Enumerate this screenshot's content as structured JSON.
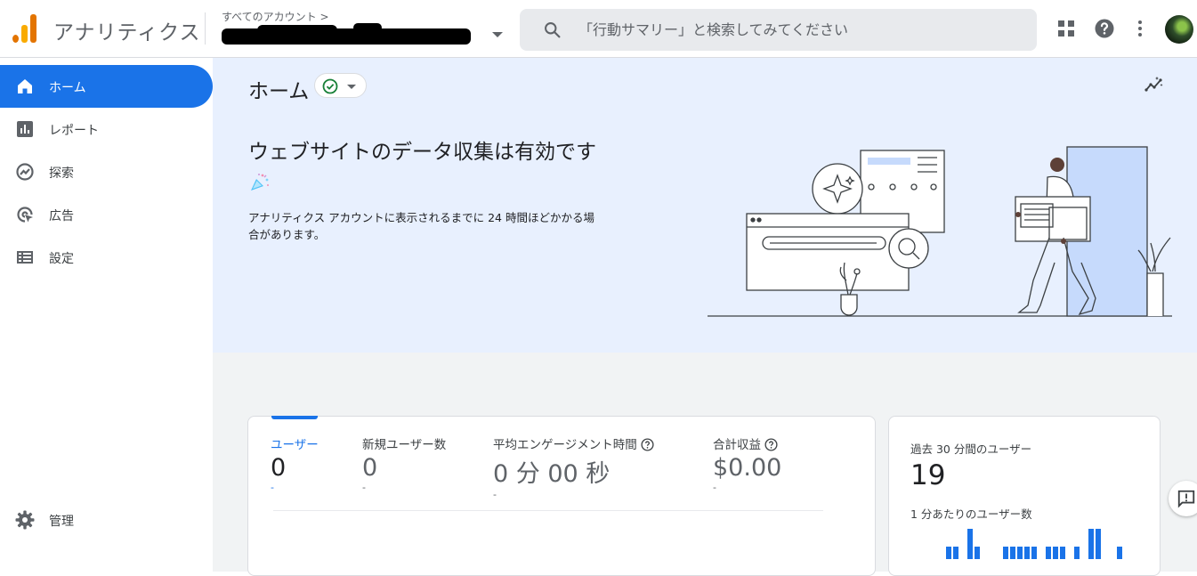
{
  "header": {
    "app_title": "アナリティクス",
    "account_breadcrumb": "すべてのアカウント >",
    "search_placeholder": "「行動サマリー」と検索してみてください"
  },
  "sidebar": {
    "items": [
      {
        "label": "ホーム",
        "icon": "home-icon",
        "active": true
      },
      {
        "label": "レポート",
        "icon": "bar-chart-icon",
        "active": false
      },
      {
        "label": "探索",
        "icon": "explore-icon",
        "active": false
      },
      {
        "label": "広告",
        "icon": "ads-icon",
        "active": false
      },
      {
        "label": "設定",
        "icon": "list-icon",
        "active": false
      }
    ],
    "admin_label": "管理"
  },
  "main": {
    "page_title": "ホーム",
    "hero_heading": "ウェブサイトのデータ収集は有効です",
    "hero_description": "アナリティクス アカウントに表示されるまでに 24 時間ほどかかる場合があります。",
    "metrics": [
      {
        "label": "ユーザー",
        "value": "0",
        "delta": "-",
        "active": true,
        "help": false
      },
      {
        "label": "新規ユーザー数",
        "value": "0",
        "delta": "-",
        "active": false,
        "help": false
      },
      {
        "label": "平均エンゲージメント時間",
        "value": "0 分 00 秒",
        "delta": "-",
        "active": false,
        "help": true
      },
      {
        "label": "合計収益",
        "value": "$0.00",
        "delta": "-",
        "active": false,
        "help": true
      }
    ],
    "realtime": {
      "label": "過去 30 分間のユーザー",
      "value": "19",
      "sub_label": "1 分あたりのユーザー数"
    }
  },
  "colors": {
    "accent": "#1a73e8",
    "hero_bg": "#e8f0fe",
    "logo_orange": "#e37400",
    "logo_yellow": "#f9ab00"
  }
}
